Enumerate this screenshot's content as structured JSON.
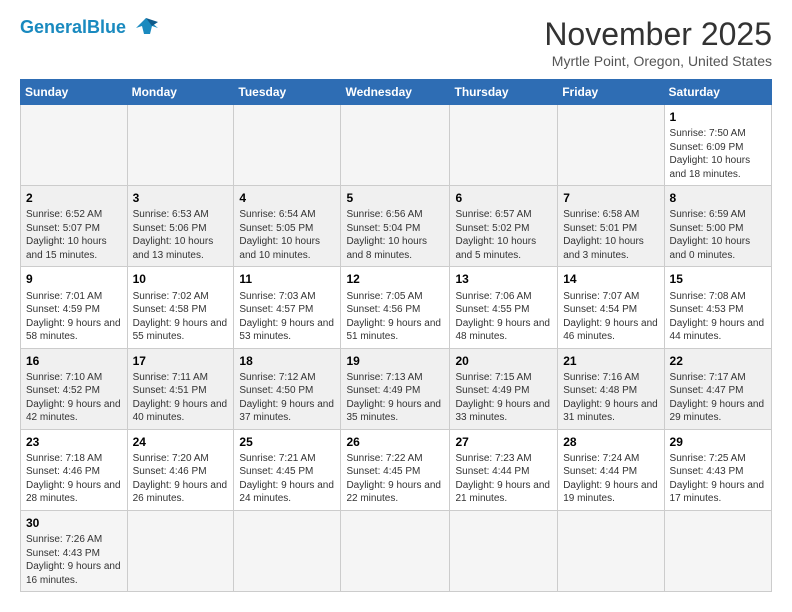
{
  "header": {
    "logo_general": "General",
    "logo_blue": "Blue",
    "month": "November 2025",
    "location": "Myrtle Point, Oregon, United States"
  },
  "days_of_week": [
    "Sunday",
    "Monday",
    "Tuesday",
    "Wednesday",
    "Thursday",
    "Friday",
    "Saturday"
  ],
  "weeks": [
    [
      {
        "day": "",
        "info": ""
      },
      {
        "day": "",
        "info": ""
      },
      {
        "day": "",
        "info": ""
      },
      {
        "day": "",
        "info": ""
      },
      {
        "day": "",
        "info": ""
      },
      {
        "day": "",
        "info": ""
      },
      {
        "day": "1",
        "info": "Sunrise: 7:50 AM\nSunset: 6:09 PM\nDaylight: 10 hours and 18 minutes."
      }
    ],
    [
      {
        "day": "2",
        "info": "Sunrise: 6:52 AM\nSunset: 5:07 PM\nDaylight: 10 hours and 15 minutes."
      },
      {
        "day": "3",
        "info": "Sunrise: 6:53 AM\nSunset: 5:06 PM\nDaylight: 10 hours and 13 minutes."
      },
      {
        "day": "4",
        "info": "Sunrise: 6:54 AM\nSunset: 5:05 PM\nDaylight: 10 hours and 10 minutes."
      },
      {
        "day": "5",
        "info": "Sunrise: 6:56 AM\nSunset: 5:04 PM\nDaylight: 10 hours and 8 minutes."
      },
      {
        "day": "6",
        "info": "Sunrise: 6:57 AM\nSunset: 5:02 PM\nDaylight: 10 hours and 5 minutes."
      },
      {
        "day": "7",
        "info": "Sunrise: 6:58 AM\nSunset: 5:01 PM\nDaylight: 10 hours and 3 minutes."
      },
      {
        "day": "8",
        "info": "Sunrise: 6:59 AM\nSunset: 5:00 PM\nDaylight: 10 hours and 0 minutes."
      }
    ],
    [
      {
        "day": "9",
        "info": "Sunrise: 7:01 AM\nSunset: 4:59 PM\nDaylight: 9 hours and 58 minutes."
      },
      {
        "day": "10",
        "info": "Sunrise: 7:02 AM\nSunset: 4:58 PM\nDaylight: 9 hours and 55 minutes."
      },
      {
        "day": "11",
        "info": "Sunrise: 7:03 AM\nSunset: 4:57 PM\nDaylight: 9 hours and 53 minutes."
      },
      {
        "day": "12",
        "info": "Sunrise: 7:05 AM\nSunset: 4:56 PM\nDaylight: 9 hours and 51 minutes."
      },
      {
        "day": "13",
        "info": "Sunrise: 7:06 AM\nSunset: 4:55 PM\nDaylight: 9 hours and 48 minutes."
      },
      {
        "day": "14",
        "info": "Sunrise: 7:07 AM\nSunset: 4:54 PM\nDaylight: 9 hours and 46 minutes."
      },
      {
        "day": "15",
        "info": "Sunrise: 7:08 AM\nSunset: 4:53 PM\nDaylight: 9 hours and 44 minutes."
      }
    ],
    [
      {
        "day": "16",
        "info": "Sunrise: 7:10 AM\nSunset: 4:52 PM\nDaylight: 9 hours and 42 minutes."
      },
      {
        "day": "17",
        "info": "Sunrise: 7:11 AM\nSunset: 4:51 PM\nDaylight: 9 hours and 40 minutes."
      },
      {
        "day": "18",
        "info": "Sunrise: 7:12 AM\nSunset: 4:50 PM\nDaylight: 9 hours and 37 minutes."
      },
      {
        "day": "19",
        "info": "Sunrise: 7:13 AM\nSunset: 4:49 PM\nDaylight: 9 hours and 35 minutes."
      },
      {
        "day": "20",
        "info": "Sunrise: 7:15 AM\nSunset: 4:49 PM\nDaylight: 9 hours and 33 minutes."
      },
      {
        "day": "21",
        "info": "Sunrise: 7:16 AM\nSunset: 4:48 PM\nDaylight: 9 hours and 31 minutes."
      },
      {
        "day": "22",
        "info": "Sunrise: 7:17 AM\nSunset: 4:47 PM\nDaylight: 9 hours and 29 minutes."
      }
    ],
    [
      {
        "day": "23",
        "info": "Sunrise: 7:18 AM\nSunset: 4:46 PM\nDaylight: 9 hours and 28 minutes."
      },
      {
        "day": "24",
        "info": "Sunrise: 7:20 AM\nSunset: 4:46 PM\nDaylight: 9 hours and 26 minutes."
      },
      {
        "day": "25",
        "info": "Sunrise: 7:21 AM\nSunset: 4:45 PM\nDaylight: 9 hours and 24 minutes."
      },
      {
        "day": "26",
        "info": "Sunrise: 7:22 AM\nSunset: 4:45 PM\nDaylight: 9 hours and 22 minutes."
      },
      {
        "day": "27",
        "info": "Sunrise: 7:23 AM\nSunset: 4:44 PM\nDaylight: 9 hours and 21 minutes."
      },
      {
        "day": "28",
        "info": "Sunrise: 7:24 AM\nSunset: 4:44 PM\nDaylight: 9 hours and 19 minutes."
      },
      {
        "day": "29",
        "info": "Sunrise: 7:25 AM\nSunset: 4:43 PM\nDaylight: 9 hours and 17 minutes."
      }
    ],
    [
      {
        "day": "30",
        "info": "Sunrise: 7:26 AM\nSunset: 4:43 PM\nDaylight: 9 hours and 16 minutes."
      },
      {
        "day": "",
        "info": ""
      },
      {
        "day": "",
        "info": ""
      },
      {
        "day": "",
        "info": ""
      },
      {
        "day": "",
        "info": ""
      },
      {
        "day": "",
        "info": ""
      },
      {
        "day": "",
        "info": ""
      }
    ]
  ]
}
